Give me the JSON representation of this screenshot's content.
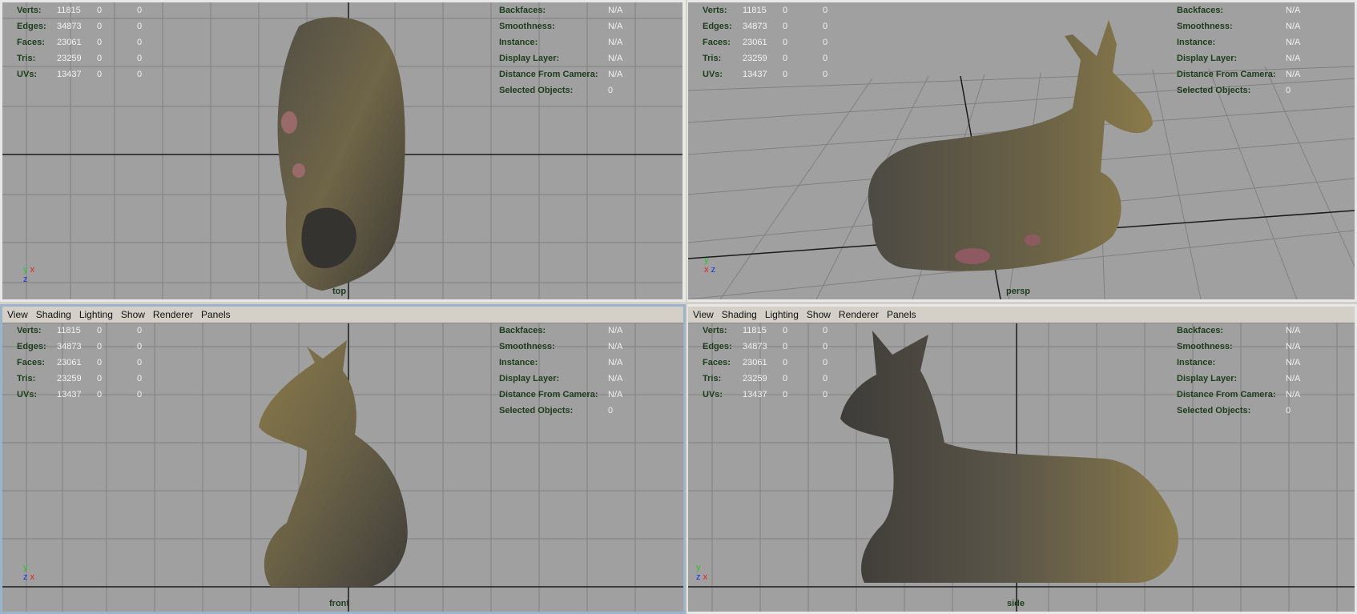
{
  "menu": {
    "items": [
      "View",
      "Shading",
      "Lighting",
      "Show",
      "Renderer",
      "Panels"
    ]
  },
  "stats": {
    "left": [
      {
        "label": "Verts:",
        "v1": "11815",
        "v2": "0",
        "v3": "0"
      },
      {
        "label": "Edges:",
        "v1": "34873",
        "v2": "0",
        "v3": "0"
      },
      {
        "label": "Faces:",
        "v1": "23061",
        "v2": "0",
        "v3": "0"
      },
      {
        "label": "Tris:",
        "v1": "23259",
        "v2": "0",
        "v3": "0"
      },
      {
        "label": "UVs:",
        "v1": "13437",
        "v2": "0",
        "v3": "0"
      }
    ],
    "right": [
      {
        "label": "Backfaces:",
        "value": "N/A"
      },
      {
        "label": "Smoothness:",
        "value": "N/A"
      },
      {
        "label": "Instance:",
        "value": "N/A"
      },
      {
        "label": "Display Layer:",
        "value": "N/A"
      },
      {
        "label": "Distance From Camera:",
        "value": "N/A"
      },
      {
        "label": "Selected Objects:",
        "value": "0"
      }
    ]
  },
  "viewports": {
    "top": {
      "label": "top"
    },
    "persp": {
      "label": "persp"
    },
    "front": {
      "label": "front"
    },
    "side": {
      "label": "side"
    }
  },
  "axes": {
    "x": "x",
    "y": "y",
    "z": "z"
  },
  "colors": {
    "viewport_bg": "#a0a0a0",
    "grid": "#7e7e7e",
    "grid_axis": "#1a1a1a",
    "hud_label": "#1c3d1c",
    "model_dark": "#3f3d3a",
    "model_light": "#8a7a4a"
  }
}
